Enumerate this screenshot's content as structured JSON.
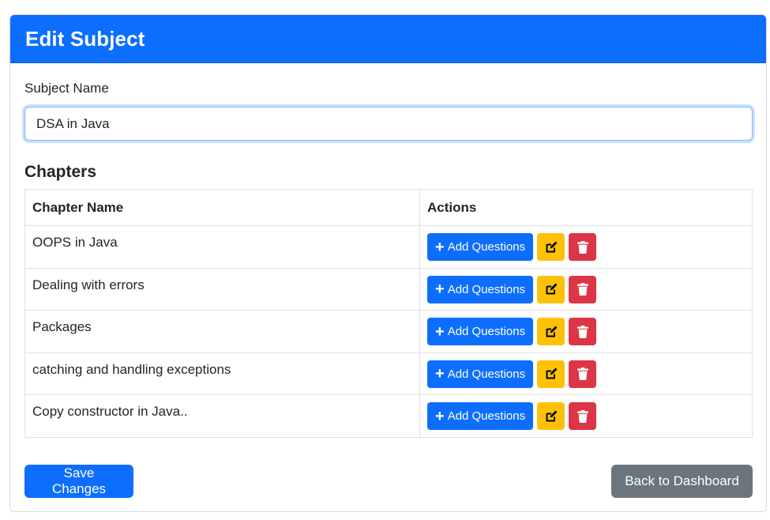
{
  "header": {
    "title": "Edit Subject"
  },
  "form": {
    "subject_label": "Subject Name",
    "subject_value": "DSA in Java"
  },
  "chapters": {
    "title": "Chapters",
    "columns": [
      "Chapter Name",
      "Actions"
    ],
    "rows": [
      {
        "name": "OOPS in Java"
      },
      {
        "name": "Dealing with errors"
      },
      {
        "name": "Packages"
      },
      {
        "name": "catching and handling exceptions"
      },
      {
        "name": "Copy constructor in Java.."
      }
    ],
    "add_label": "Add Questions",
    "add_icon": "plus-icon",
    "edit_icon": "edit-icon",
    "delete_icon": "trash-icon"
  },
  "footer": {
    "save_label": "Save Changes",
    "back_label": "Back to Dashboard"
  },
  "colors": {
    "primary": "#0d6efd",
    "warning": "#ffc107",
    "danger": "#dc3545",
    "secondary": "#6c757d"
  }
}
